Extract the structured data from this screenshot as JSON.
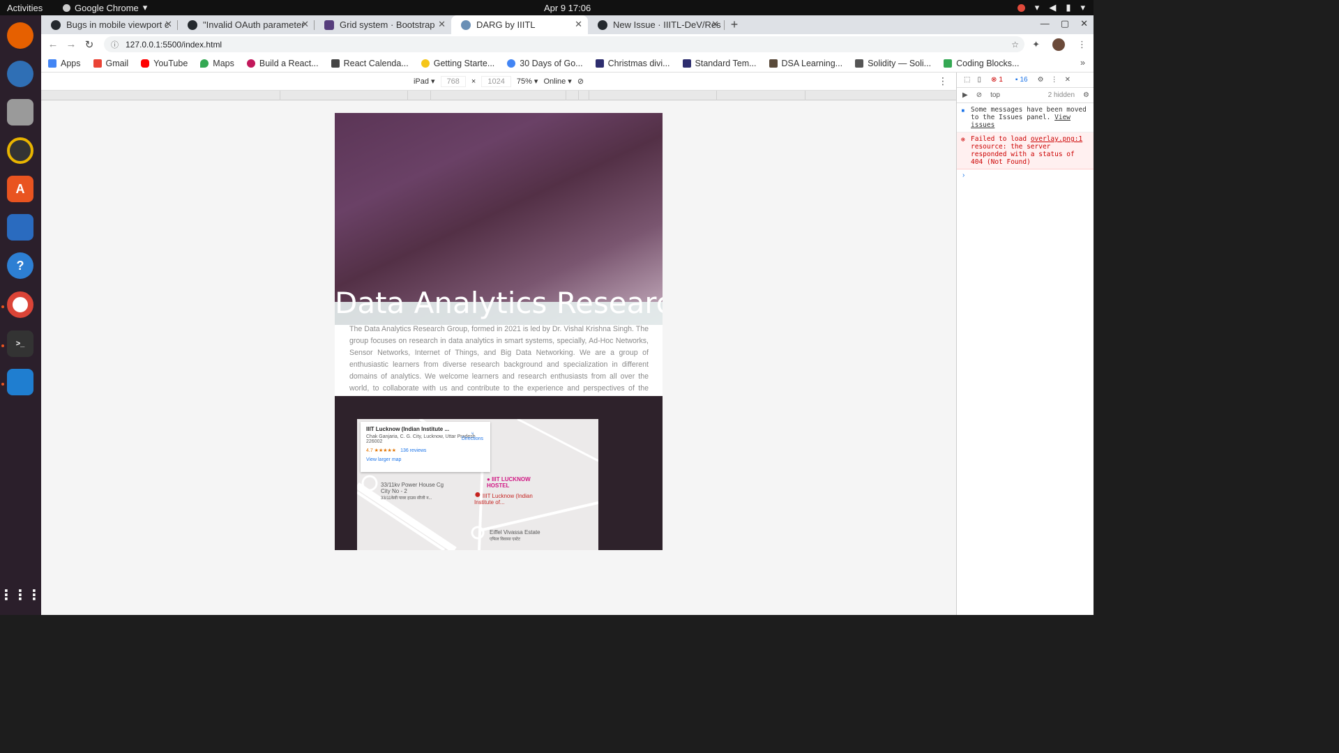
{
  "system": {
    "activities": "Activities",
    "app_name": "Google Chrome",
    "clock": "Apr 9  17:06"
  },
  "tabs": [
    {
      "label": "Bugs in mobile viewport c"
    },
    {
      "label": "\"Invalid OAuth parameter"
    },
    {
      "label": "Grid system · Bootstrap"
    },
    {
      "label": "DARG by IIITL"
    },
    {
      "label": "New Issue · IIITL-DeV/Res"
    }
  ],
  "address": {
    "url": "127.0.0.1:5500/index.html"
  },
  "bookmarks": [
    {
      "label": "Apps"
    },
    {
      "label": "Gmail"
    },
    {
      "label": "YouTube"
    },
    {
      "label": "Maps"
    },
    {
      "label": "Build a React..."
    },
    {
      "label": "React Calenda..."
    },
    {
      "label": "Getting Starte..."
    },
    {
      "label": "30 Days of Go..."
    },
    {
      "label": "Christmas divi..."
    },
    {
      "label": "Standard Tem..."
    },
    {
      "label": "DSA Learning..."
    },
    {
      "label": "Solidity — Soli..."
    },
    {
      "label": "Coding Blocks..."
    }
  ],
  "device_toolbar": {
    "device": "iPad",
    "width": "768",
    "height": "1024",
    "zoom": "75%",
    "network": "Online"
  },
  "page": {
    "hero_title": "Data Analytics Research",
    "about_text": "The Data Analytics Research Group, formed in 2021 is led by Dr. Vishal Krishna Singh. The group focuses on research in data analytics in smart systems, specially, Ad-Hoc Networks, Sensor Networks, Internet of Things, and Big Data Networking. We are a group of enthusiastic learners from diverse research background and specialization in different domains of analytics. We welcome learners and research enthusiasts from all over the world, to collaborate with us and contribute to the experience and perspectives of the group.",
    "map": {
      "place_name": "IIIT Lucknow (Indian Institute ...",
      "address": "Chak Ganjaria, C. G. City, Lucknow, Uttar Pradesh 226002",
      "rating": "4.7 ★★★★★",
      "reviews": "136 reviews",
      "larger_map": "View larger map",
      "directions": "Directions",
      "label_hostel": "IIIT LUCKNOW HOSTEL",
      "label_institute": "IIIT Lucknow (Indian Institute of...",
      "label_power": "33/11kv Power House Cg City No - 2",
      "label_power_hi": "33/11केवी पावर हाउस सीजी न...",
      "label_estate": "Eiffel Vivassa Estate",
      "label_estate_hi": "एफिल विवासा एस्टेट"
    }
  },
  "devtools": {
    "errors": "1",
    "messages": "16",
    "context": "top",
    "hidden": "2 hidden",
    "msg1": "Some messages have been moved to the Issues panel.",
    "msg1_link": "View issues",
    "err_prefix": "Failed to load",
    "err_link": "overlay.png:1",
    "err_rest": "resource: the server responded with a status of 404 (Not Found)",
    "prompt": "›"
  },
  "colors": {
    "hero_start": "#5b3556",
    "footer_bg": "#2e222b",
    "error_red": "#c00"
  }
}
